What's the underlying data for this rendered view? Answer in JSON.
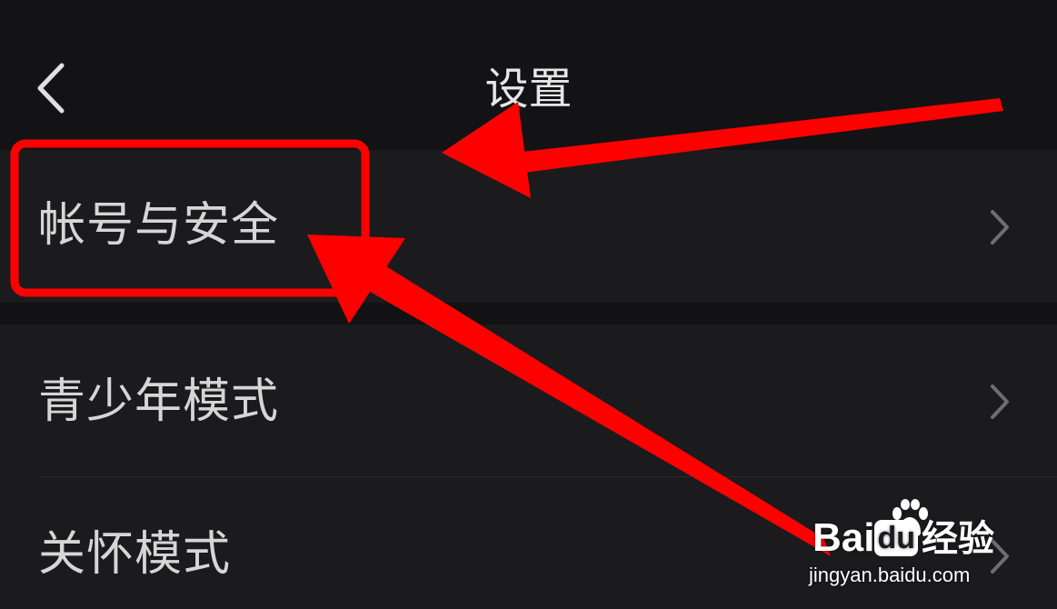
{
  "header": {
    "title": "设置",
    "back_icon": "chevron-left-icon"
  },
  "settings": {
    "items": [
      {
        "label": "帐号与安全",
        "icon": "chevron-right-icon"
      },
      {
        "label": "青少年模式",
        "icon": "chevron-right-icon"
      },
      {
        "label": "关怀模式",
        "icon": "chevron-right-icon"
      }
    ]
  },
  "annotations": {
    "highlight_color": "#ff0000",
    "highlighted_item": "帐号与安全"
  },
  "watermark": {
    "brand_a": "Bai",
    "brand_b": "du",
    "brand_c": "经验",
    "url": "jingyan.baidu.com"
  }
}
